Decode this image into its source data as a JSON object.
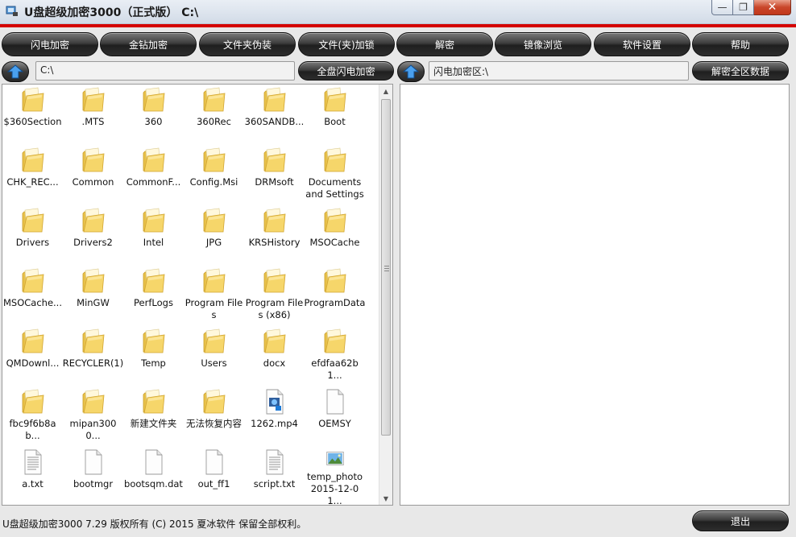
{
  "window": {
    "title": "U盘超级加密3000（正式版） C:\\",
    "controls": {
      "minimize": "—",
      "maximize": "❐",
      "close": "✕"
    }
  },
  "toolbar": {
    "buttons": [
      "闪电加密",
      "金钻加密",
      "文件夹伪装",
      "文件(夹)加锁",
      "解密",
      "镜像浏览",
      "软件设置",
      "帮助"
    ]
  },
  "left_address": {
    "value": "C:\\",
    "action_label": "全盘闪电加密"
  },
  "right_address": {
    "value": "闪电加密区:\\",
    "action_label": "解密全区数据"
  },
  "files": [
    {
      "name": "$360Section",
      "icon": "folder-icon"
    },
    {
      "name": ".MTS",
      "icon": "folder-icon"
    },
    {
      "name": "360",
      "icon": "folder-icon"
    },
    {
      "name": "360Rec",
      "icon": "folder-icon"
    },
    {
      "name": "360SANDB...",
      "icon": "folder-icon"
    },
    {
      "name": "Boot",
      "icon": "folder-icon"
    },
    {
      "name": "CHK_REC...",
      "icon": "folder-icon"
    },
    {
      "name": "Common",
      "icon": "folder-icon"
    },
    {
      "name": "CommonF...",
      "icon": "folder-icon"
    },
    {
      "name": "Config.Msi",
      "icon": "folder-icon"
    },
    {
      "name": "DRMsoft",
      "icon": "folder-icon"
    },
    {
      "name": "Documents and Settings",
      "icon": "folder-icon"
    },
    {
      "name": "Drivers",
      "icon": "folder-icon"
    },
    {
      "name": "Drivers2",
      "icon": "folder-icon"
    },
    {
      "name": "Intel",
      "icon": "folder-icon"
    },
    {
      "name": "JPG",
      "icon": "folder-icon"
    },
    {
      "name": "KRSHistory",
      "icon": "folder-icon"
    },
    {
      "name": "MSOCache",
      "icon": "folder-icon"
    },
    {
      "name": "MSOCache...",
      "icon": "folder-icon"
    },
    {
      "name": "MinGW",
      "icon": "folder-icon"
    },
    {
      "name": "PerfLogs",
      "icon": "folder-icon"
    },
    {
      "name": "Program Files",
      "icon": "folder-icon"
    },
    {
      "name": "Program Files (x86)",
      "icon": "folder-icon"
    },
    {
      "name": "ProgramData",
      "icon": "folder-icon"
    },
    {
      "name": "QMDownl...",
      "icon": "folder-icon"
    },
    {
      "name": "RECYCLER(1)",
      "icon": "folder-icon"
    },
    {
      "name": "Temp",
      "icon": "folder-icon"
    },
    {
      "name": "Users",
      "icon": "folder-icon"
    },
    {
      "name": "docx",
      "icon": "folder-icon"
    },
    {
      "name": "efdfaa62b1...",
      "icon": "folder-icon"
    },
    {
      "name": "fbc9f6b8ab...",
      "icon": "folder-icon"
    },
    {
      "name": "mipan3000...",
      "icon": "folder-icon"
    },
    {
      "name": "新建文件夹",
      "icon": "folder-icon"
    },
    {
      "name": "无法恢复内容",
      "icon": "folder-icon"
    },
    {
      "name": "1262.mp4",
      "icon": "video-file-icon"
    },
    {
      "name": "OEMSY",
      "icon": "blank-file-icon"
    },
    {
      "name": "a.txt",
      "icon": "text-file-icon"
    },
    {
      "name": "bootmgr",
      "icon": "blank-file-icon"
    },
    {
      "name": "bootsqm.dat",
      "icon": "blank-file-icon"
    },
    {
      "name": "out_ff1",
      "icon": "blank-file-icon"
    },
    {
      "name": "script.txt",
      "icon": "text-file-icon"
    },
    {
      "name": "temp_photo 2015-12-01...",
      "icon": "image-file-icon"
    }
  ],
  "status": {
    "text": "U盘超级加密3000  7.29 版权所有 (C) 2015 夏冰软件 保留全部权利。",
    "exit_label": "退出"
  },
  "colors": {
    "accent_red": "#d40000",
    "button_dark": "#2d2d2d",
    "folder_yellow": "#f2cf5b"
  }
}
